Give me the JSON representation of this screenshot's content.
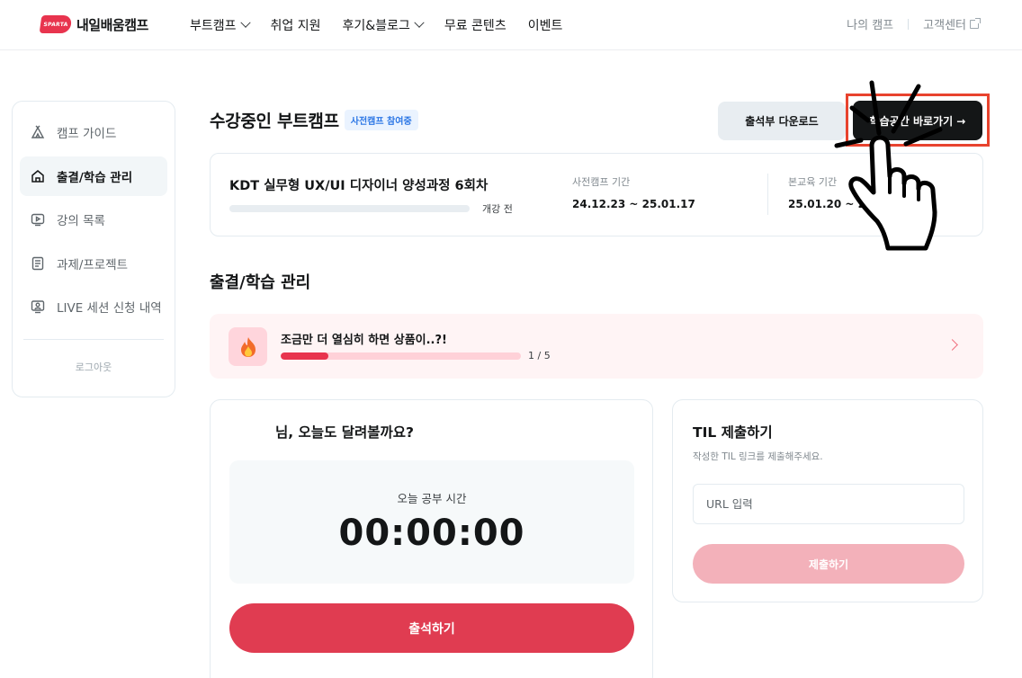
{
  "header": {
    "logo_badge": "SPARTA",
    "logo_text": "내일배움캠프",
    "nav": [
      {
        "label": "부트캠프",
        "dropdown": true
      },
      {
        "label": "취업 지원",
        "dropdown": false
      },
      {
        "label": "후기&블로그",
        "dropdown": true
      },
      {
        "label": "무료 콘텐츠",
        "dropdown": false
      },
      {
        "label": "이벤트",
        "dropdown": false
      }
    ],
    "my_camp": "나의 캠프",
    "help_center": "고객센터"
  },
  "sidebar": {
    "items": [
      {
        "label": "캠프 가이드",
        "icon": "tent-icon",
        "active": false
      },
      {
        "label": "출결/학습 관리",
        "icon": "home-icon",
        "active": true
      },
      {
        "label": "강의 목록",
        "icon": "video-icon",
        "active": false
      },
      {
        "label": "과제/프로젝트",
        "icon": "document-icon",
        "active": false
      },
      {
        "label": "LIVE 세션 신청 내역",
        "icon": "monitor-user-icon",
        "active": false
      }
    ],
    "logout": "로그아웃"
  },
  "main": {
    "title": "수강중인 부트캠프",
    "badge": "사전캠프 참여중",
    "attendance_download": "출석부 다운로드",
    "study_space": "학습공간 바로가기 →",
    "course": {
      "name": "KDT 실무형 UX/UI 디자이너 양성과정 6회차",
      "progress": 0,
      "status": "개강 전",
      "pre_camp_label": "사전캠프 기간",
      "pre_camp_dates": "24.12.23 ~ 25.01.17",
      "main_label": "본교육 기간",
      "main_dates": "25.01.20 ~ 25.0"
    },
    "section_title": "출결/학습 관리",
    "motivation": {
      "text": "조금만 더 열심히 하면 상품이..?!",
      "count": "1 / 5",
      "current": 1,
      "total": 5
    },
    "study": {
      "greeting": "님, 오늘도 달려볼까요?",
      "timer_label": "오늘 공부 시간",
      "timer_value": "00:00:00",
      "attend_button": "출석하기"
    },
    "til": {
      "title": "TIL 제출하기",
      "description": "작성한 TIL 링크를 제출해주세요.",
      "placeholder": "URL 입력",
      "submit": "제출하기"
    }
  },
  "colors": {
    "brand": "#e8344e",
    "button_dark": "#141617",
    "highlight_box": "#e8432e",
    "submit_disabled": "#f3b1ba"
  }
}
